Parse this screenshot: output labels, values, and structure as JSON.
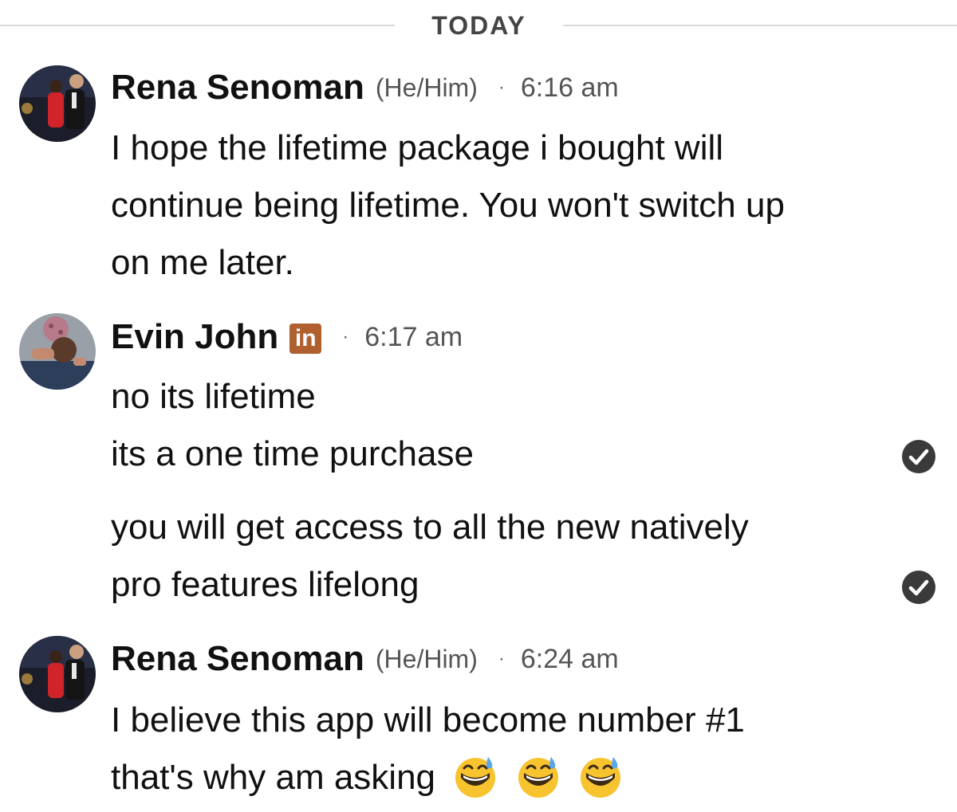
{
  "date_divider": "TODAY",
  "messages": [
    {
      "name": "Rena Senoman",
      "pronouns": "(He/Him)",
      "time": "6:16 am",
      "lines": [
        "I hope the lifetime package i bought will",
        "continue being lifetime. You won't switch up",
        "on me later."
      ]
    },
    {
      "name": "Evin John",
      "badge": "in",
      "time": "6:17 am",
      "lines": [
        "no its lifetime",
        "its a one time purchase",
        "you will get access to all the new natively",
        "pro features lifelong"
      ]
    },
    {
      "name": "Rena Senoman",
      "pronouns": "(He/Him)",
      "time": "6:24 am",
      "lines": [
        "I believe this app will become number #1",
        "that's why am asking"
      ]
    }
  ],
  "icons": {
    "linkedin_badge": "linkedin-icon",
    "read_receipt": "checkmark-circle-icon",
    "emoji": "grinning-face-with-sweat-emoji"
  },
  "colors": {
    "text": "#111111",
    "meta": "#555555",
    "divider": "#d9d9d9",
    "badge": "#b0602f",
    "check_bg": "#3a3a3a"
  },
  "separator_dot": "·"
}
